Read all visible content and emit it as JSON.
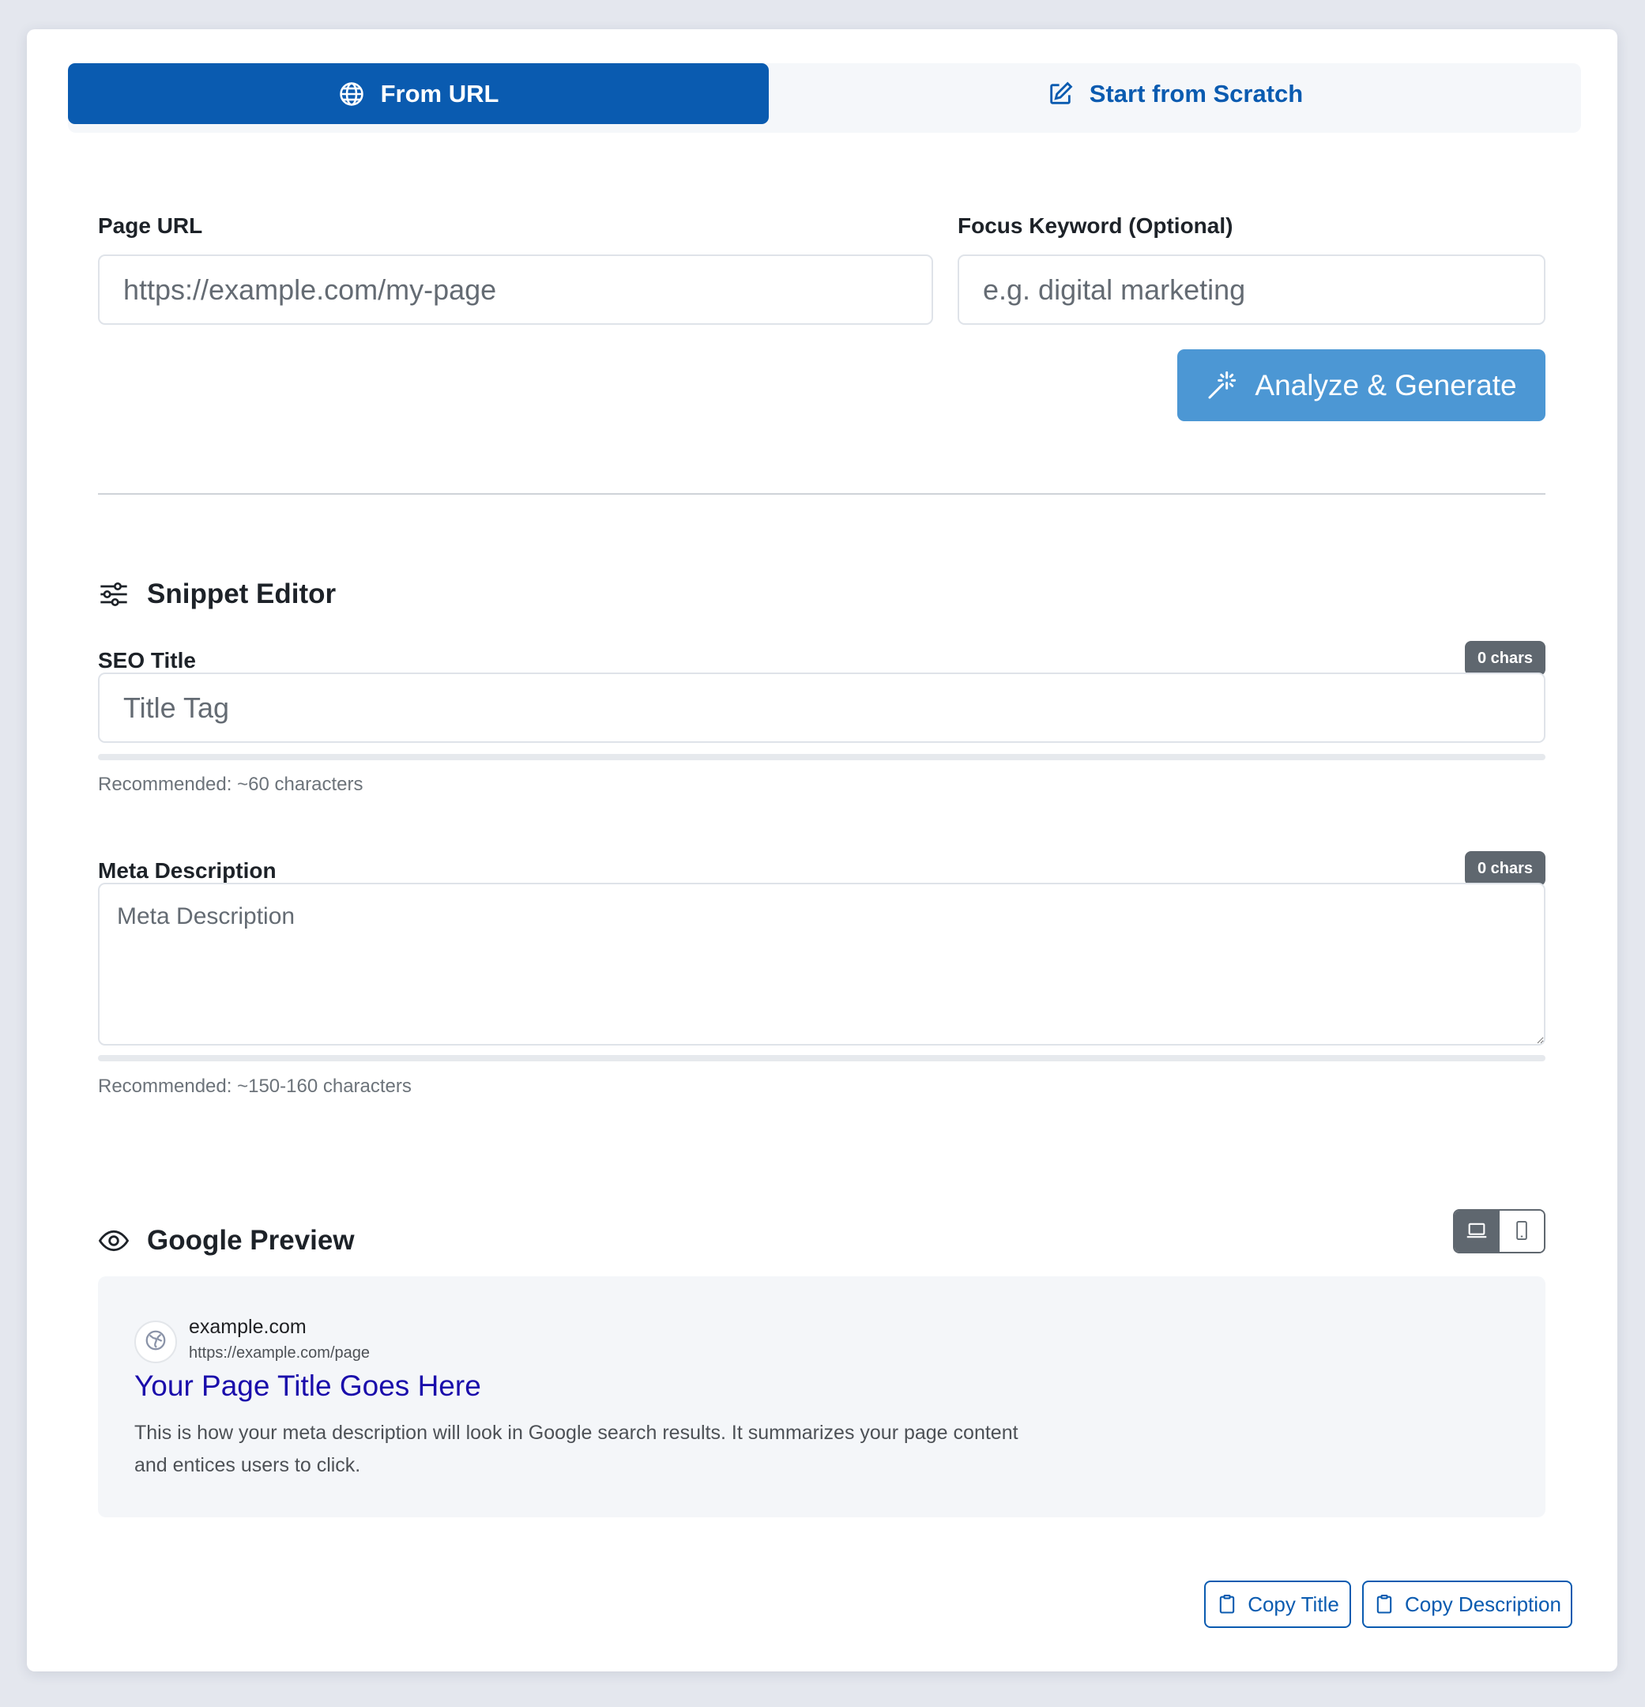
{
  "tabs": {
    "from_url": {
      "label": "From URL",
      "icon": "globe-icon",
      "active": true
    },
    "scratch": {
      "label": "Start from Scratch",
      "icon": "edit-icon",
      "active": false
    }
  },
  "url_form": {
    "page_url_label": "Page URL",
    "page_url_placeholder": "https://example.com/my-page",
    "page_url_value": "",
    "keyword_label": "Focus Keyword (Optional)",
    "keyword_placeholder": "e.g. digital marketing",
    "keyword_value": "",
    "analyze_button": "Analyze & Generate"
  },
  "snippet_editor": {
    "heading": "Snippet Editor",
    "icon": "sliders-icon",
    "title_label": "SEO Title",
    "title_count": "0 chars",
    "title_placeholder": "Title Tag",
    "title_value": "",
    "title_hint": "Recommended: ~60 characters",
    "desc_label": "Meta Description",
    "desc_count": "0 chars",
    "desc_placeholder": "Meta Description",
    "desc_value": "",
    "desc_hint": "Recommended: ~150-160 characters"
  },
  "preview": {
    "heading": "Google Preview",
    "icon": "eye-icon",
    "device_selected": "desktop",
    "site_name": "example.com",
    "url": "https://example.com/page",
    "title": "Your Page Title Goes Here",
    "description": "This is how your meta description will look in Google search results. It summarizes your page content and entices users to click."
  },
  "actions": {
    "copy_title": "Copy Title",
    "copy_description": "Copy Description"
  },
  "colors": {
    "primary": "#0a5bb0",
    "button_light": "#4c97d4",
    "badge": "#5f676f",
    "serp_title": "#1a0dab"
  }
}
